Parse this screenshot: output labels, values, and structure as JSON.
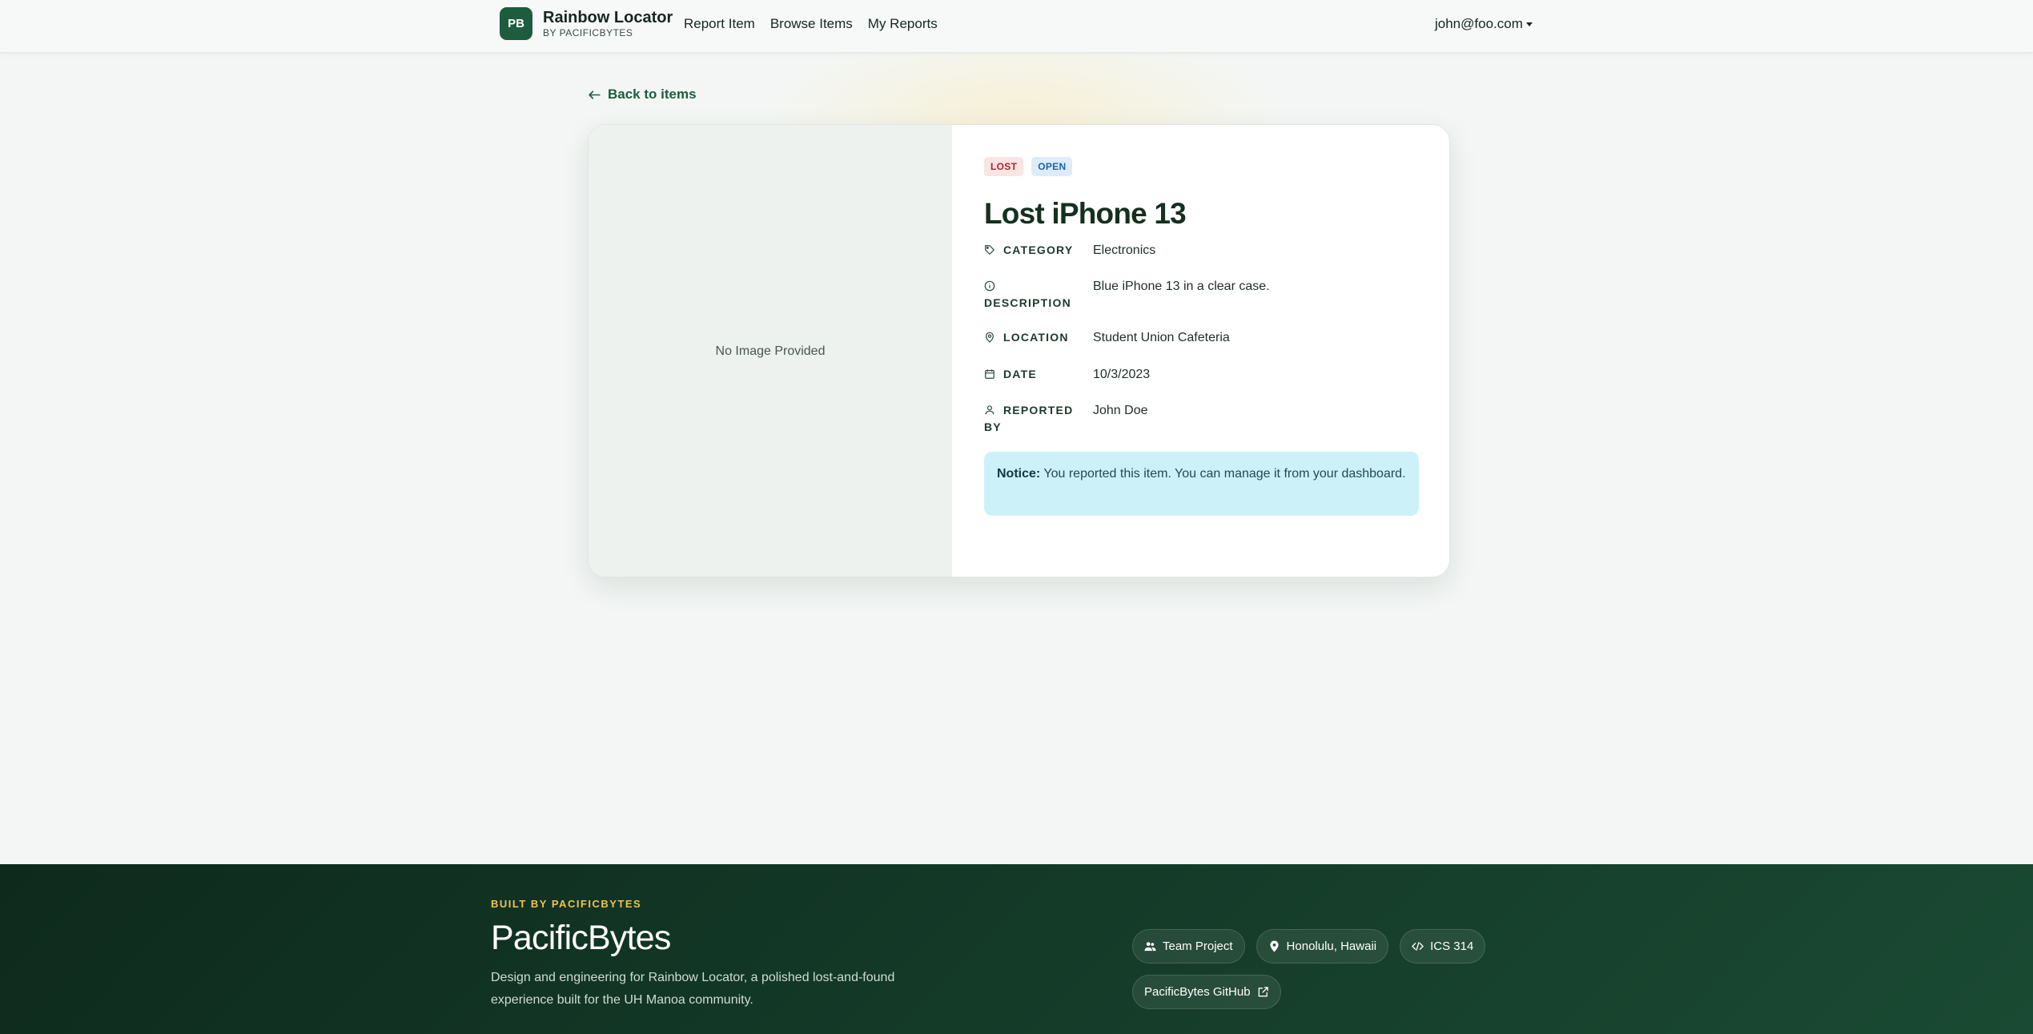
{
  "navbar": {
    "logo_text": "PB",
    "brand_title": "Rainbow Locator",
    "brand_sub": "BY PACIFICBYTES",
    "links": [
      "Report Item",
      "Browse Items",
      "My Reports"
    ],
    "user": "john@foo.com"
  },
  "back_link": "Back to items",
  "item": {
    "image_placeholder": "No Image Provided",
    "badges": {
      "type": "LOST",
      "status": "OPEN"
    },
    "title": "Lost iPhone 13",
    "fields": {
      "category": {
        "label": "CATEGORY",
        "value": "Electronics"
      },
      "description": {
        "label": "DESCRIPTION",
        "value": "Blue iPhone 13 in a clear case."
      },
      "location": {
        "label": "LOCATION",
        "value": "Student Union Cafeteria"
      },
      "date": {
        "label": "DATE",
        "value": "10/3/2023"
      },
      "reported_by": {
        "label": "REPORTED BY",
        "value": "John Doe"
      }
    },
    "notice": {
      "label": "Notice:",
      "text": "You reported this item. You can manage it from your dashboard."
    }
  },
  "footer": {
    "eyebrow": "BUILT BY PACIFICBYTES",
    "title": "PacificBytes",
    "description": "Design and engineering for Rainbow Locator, a polished lost-and-found experience built for the UH Manoa community.",
    "chips": {
      "team": "Team Project",
      "location": "Honolulu, Hawaii",
      "course": "ICS 314",
      "github": "PacificBytes GitHub"
    }
  },
  "colors": {
    "brand_green": "#1d5c3e",
    "lost_badge": "#b0242b",
    "open_badge": "#1d63a6",
    "notice_bg": "#cdf1f8",
    "footer_accent": "#f2c14e"
  }
}
